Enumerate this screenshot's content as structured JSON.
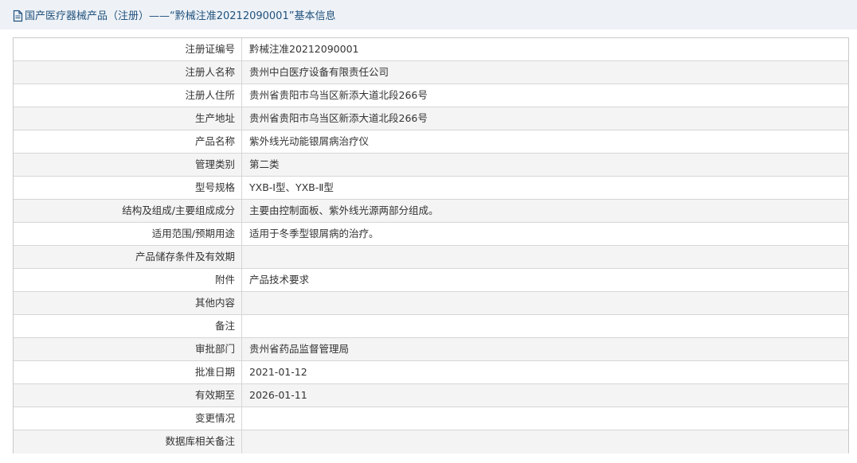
{
  "header": {
    "icon": "document-icon",
    "title": "国产医疗器械产品（注册）——“黔械注准20212090001”基本信息"
  },
  "colors": {
    "header_bg": "#eef2f7",
    "header_text": "#21527d",
    "row_alt_bg": "#f4f4f4",
    "border": "#d6d6d6"
  },
  "rows": [
    {
      "label": "注册证编号",
      "value": "黔械注准20212090001"
    },
    {
      "label": "注册人名称",
      "value": "贵州中白医疗设备有限责任公司"
    },
    {
      "label": "注册人住所",
      "value": "贵州省贵阳市乌当区新添大道北段266号"
    },
    {
      "label": "生产地址",
      "value": "贵州省贵阳市乌当区新添大道北段266号"
    },
    {
      "label": "产品名称",
      "value": "紫外线光动能银屑病治疗仪"
    },
    {
      "label": "管理类别",
      "value": "第二类"
    },
    {
      "label": "型号规格",
      "value": "YXB-Ⅰ型、YXB-Ⅱ型"
    },
    {
      "label": "结构及组成/主要组成成分",
      "value": "主要由控制面板、紫外线光源两部分组成。"
    },
    {
      "label": "适用范围/预期用途",
      "value": "适用于冬季型银屑病的治疗。"
    },
    {
      "label": "产品储存条件及有效期",
      "value": ""
    },
    {
      "label": "附件",
      "value": "产品技术要求"
    },
    {
      "label": "其他内容",
      "value": ""
    },
    {
      "label": "备注",
      "value": ""
    },
    {
      "label": "审批部门",
      "value": "贵州省药品监督管理局"
    },
    {
      "label": "批准日期",
      "value": "2021-01-12"
    },
    {
      "label": "有效期至",
      "value": "2026-01-11"
    },
    {
      "label": "变更情况",
      "value": ""
    },
    {
      "label": "数据库相关备注",
      "value": ""
    }
  ]
}
